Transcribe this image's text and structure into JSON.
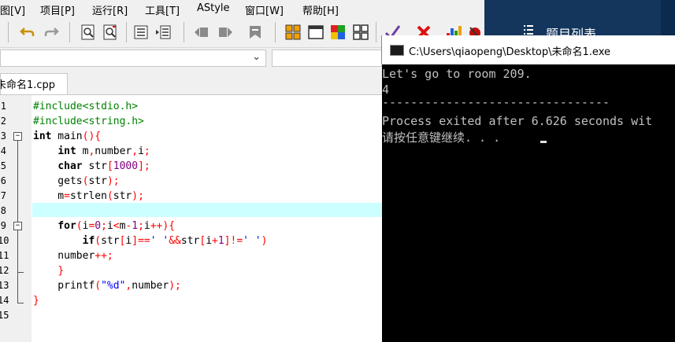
{
  "menu": {
    "items": [
      "图[V]",
      "项目[P]",
      "运行[R]",
      "工具[T]",
      "AStyle",
      "窗口[W]",
      "帮助[H]"
    ]
  },
  "toolbar": {
    "icons": [
      "undo-icon",
      "redo-icon",
      "find-icon",
      "find-next-icon",
      "indent-icon",
      "unindent-icon",
      "bookmark-prev-icon",
      "bookmark-next-icon",
      "bookmark-icon",
      "grid-icon",
      "window-icon",
      "palette-icon",
      "tiles-icon",
      "check-icon",
      "stop-icon",
      "chart-icon",
      "debug-icon"
    ]
  },
  "dropdown": {
    "chevron": "⌄"
  },
  "tab": {
    "label": "未命名1.cpp"
  },
  "editor": {
    "line_numbers": [
      "1",
      "2",
      "3",
      "4",
      "5",
      "6",
      "7",
      "8",
      "9",
      "10",
      "11",
      "12",
      "13",
      "14",
      "15"
    ]
  },
  "console": {
    "title": "C:\\Users\\qiaopeng\\Desktop\\未命名1.exe",
    "lines": [
      "Let's go to room 209.",
      "4",
      "--------------------------------",
      "Process exited after 6.626 seconds wit",
      "请按任意键继续. . ."
    ]
  },
  "side_panel": {
    "label": "题目列表"
  },
  "colors": {
    "highlight_line": "#ccffff",
    "preprocessor": "#008000",
    "operator": "#ff0000",
    "string": "#0000ff",
    "console_bg": "#000000",
    "panel_blue": "#14365c"
  }
}
